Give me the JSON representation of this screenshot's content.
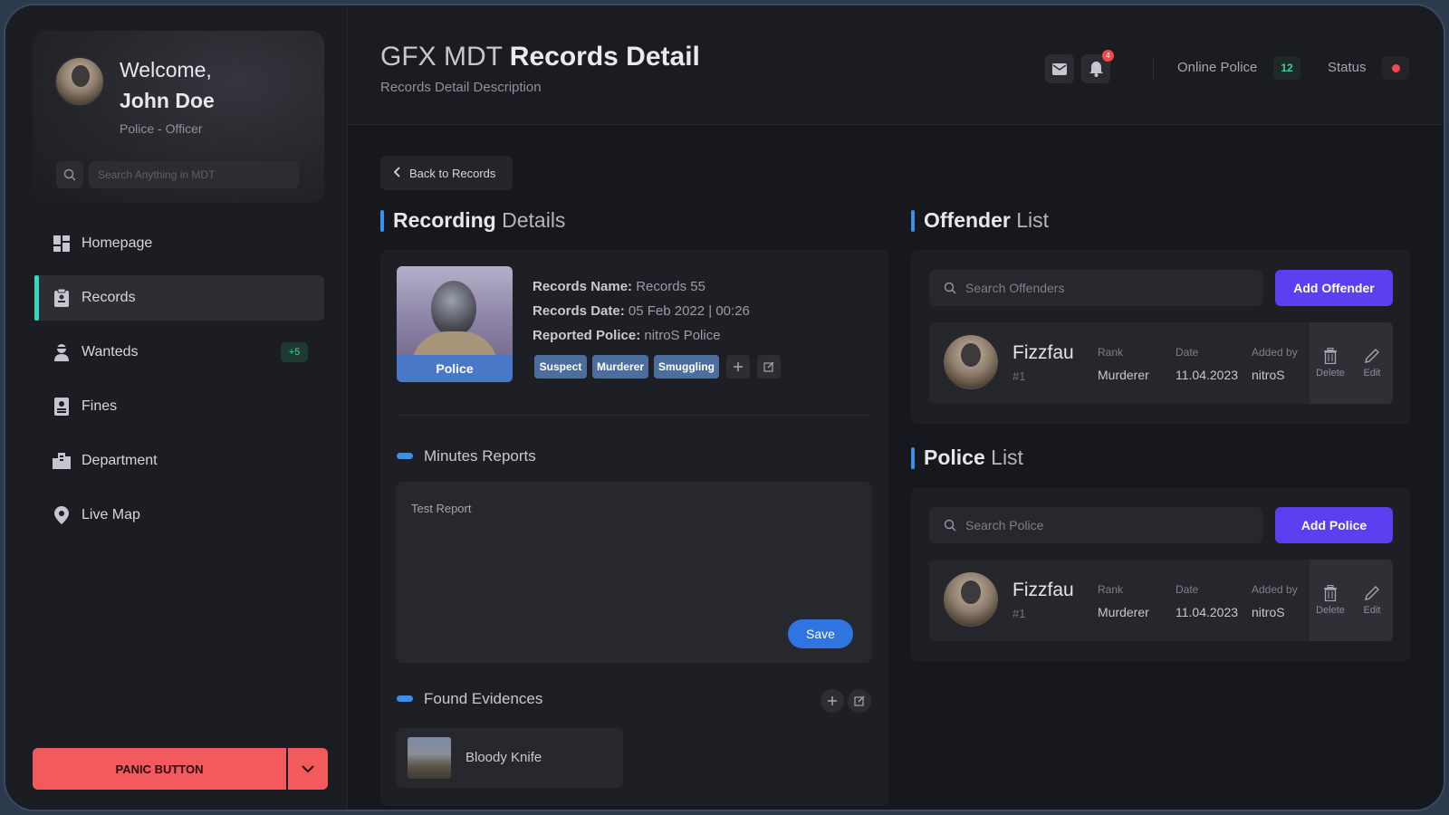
{
  "app": {
    "title_light": "GFX MDT",
    "title_bold": "Records Detail",
    "subtitle": "Records Detail Description"
  },
  "profile": {
    "welcome": "Welcome,",
    "name": "John Doe",
    "role": "Police - Officer",
    "search_placeholder": "Search Anything in MDT"
  },
  "sidebar": {
    "items": [
      {
        "label": "Homepage",
        "icon": "dashboard-icon"
      },
      {
        "label": "Records",
        "icon": "clipboard-icon",
        "active": true
      },
      {
        "label": "Wanteds",
        "icon": "person-icon",
        "badge": "+5"
      },
      {
        "label": "Fines",
        "icon": "document-icon"
      },
      {
        "label": "Department",
        "icon": "building-icon"
      },
      {
        "label": "Live Map",
        "icon": "map-pin-icon"
      }
    ],
    "panic_label": "PANIC BUTTON"
  },
  "header": {
    "notification_count": "4",
    "online_police_label": "Online Police",
    "online_police_count": "12",
    "status_label": "Status",
    "status_color": "#f2474d"
  },
  "main": {
    "back_label": "Back to Records",
    "recording": {
      "title_bold": "Recording",
      "title_light": "Details",
      "photo_label": "Police",
      "name_label": "Records Name:",
      "name_value": "Records 55",
      "date_label": "Records Date:",
      "date_value": "05 Feb 2022 | 00:26",
      "reported_label": "Reported Police:",
      "reported_value": "nitroS Police",
      "tags": [
        "Suspect",
        "Murderer",
        "Smuggling"
      ],
      "minutes_title": "Minutes Reports",
      "report_text": "Test Report",
      "save_label": "Save",
      "evidences_title": "Found Evidences",
      "evidences": [
        {
          "name": "Bloody Knife"
        }
      ]
    },
    "offenders": {
      "title_bold": "Offender",
      "title_light": "List",
      "search_placeholder": "Search Offenders",
      "add_label": "Add Offender",
      "items": [
        {
          "name": "Fizzfau",
          "num": "#1",
          "rank_label": "Rank",
          "rank": "Murderer",
          "date_label": "Date",
          "date": "11.04.2023",
          "added_label": "Added by",
          "added_by": "nitroS",
          "delete_label": "Delete",
          "edit_label": "Edit"
        }
      ]
    },
    "police": {
      "title_bold": "Police",
      "title_light": "List",
      "search_placeholder": "Search Police",
      "add_label": "Add Police",
      "items": [
        {
          "name": "Fizzfau",
          "num": "#1",
          "rank_label": "Rank",
          "rank": "Murderer",
          "date_label": "Date",
          "date": "11.04.2023",
          "added_label": "Added by",
          "added_by": "nitroS",
          "delete_label": "Delete",
          "edit_label": "Edit"
        }
      ]
    }
  },
  "colors": {
    "accent_blue": "#3c8fea",
    "accent_teal": "#34d8c0",
    "add_button": "#5b3ff0",
    "panic": "#f35a5e",
    "tag": "#4c6e9e"
  }
}
